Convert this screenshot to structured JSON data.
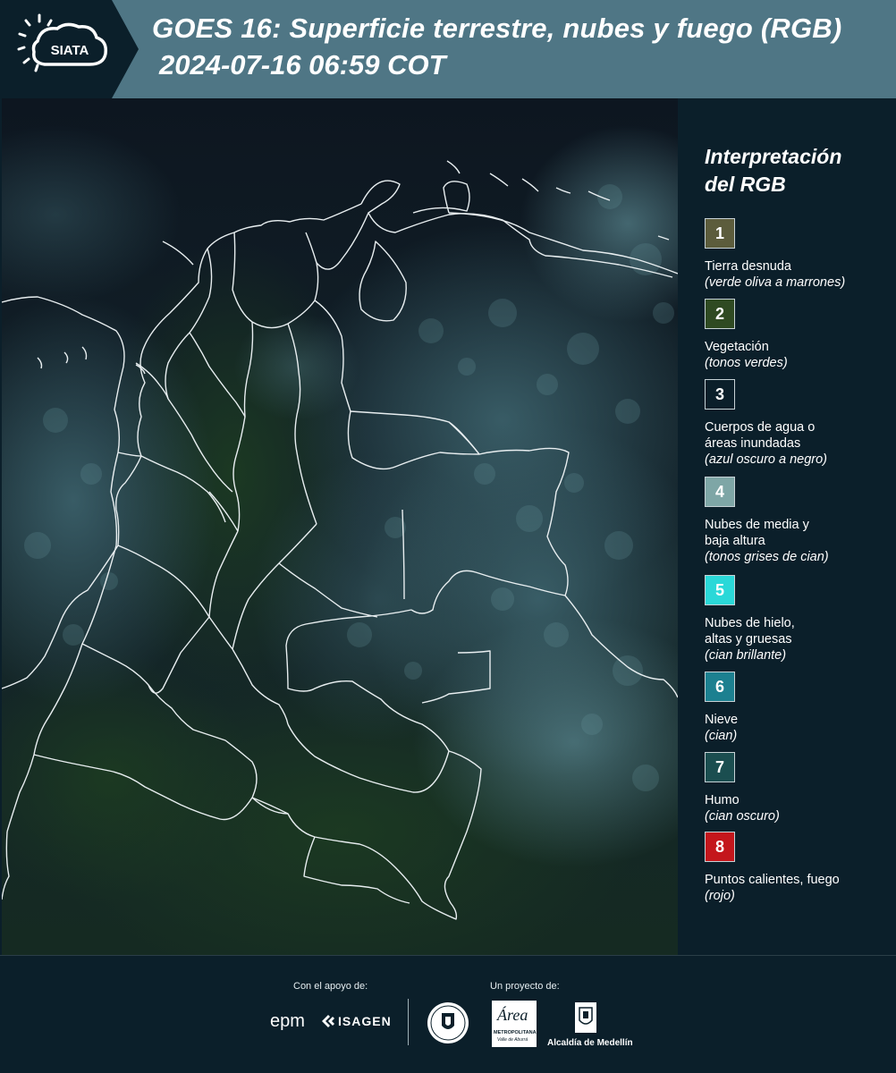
{
  "header": {
    "logo_text": "SIATA",
    "title_line1": "GOES 16: Superficie terrestre, nubes y fuego (RGB)",
    "title_line2": "2024-07-16 06:59 COT"
  },
  "map": {
    "icon": "satellite-map-icon"
  },
  "legend": {
    "title_line1": "Interpretación",
    "title_line2": "del RGB",
    "items": [
      {
        "number": "1",
        "color": "#5c5c3c",
        "label": "Tierra desnuda",
        "label2": "",
        "sub": "(verde oliva a marrones)"
      },
      {
        "number": "2",
        "color": "#2f4a22",
        "label": "Vegetación",
        "label2": "",
        "sub": "(tonos verdes)"
      },
      {
        "number": "3",
        "color": "#0b1f2a",
        "label": "Cuerpos de agua o",
        "label2": "áreas inundadas",
        "sub": "(azul oscuro a negro)"
      },
      {
        "number": "4",
        "color": "#7ea6a6",
        "label": "Nubes de media y",
        "label2": "baja altura",
        "sub": "(tonos grises de cian)"
      },
      {
        "number": "5",
        "color": "#2ad8d8",
        "label": "Nubes de hielo,",
        "label2": "altas y gruesas",
        "sub": "(cian brillante)"
      },
      {
        "number": "6",
        "color": "#1c8090",
        "label": "Nieve",
        "label2": "",
        "sub": "(cian)"
      },
      {
        "number": "7",
        "color": "#1b4e50",
        "label": "Humo",
        "label2": "",
        "sub": "(cian oscuro)"
      },
      {
        "number": "8",
        "color": "#c4161c",
        "label": "Puntos calientes, fuego",
        "label2": "",
        "sub": "(rojo)"
      }
    ]
  },
  "footer": {
    "support_label": "Con el apoyo de:",
    "project_label": "Un proyecto de:",
    "sponsor1": "epm",
    "sponsor2": "ISAGEN",
    "area_name": "Área",
    "area_sub": "METROPOLITANA",
    "area_sub2": "Valle de Aburrá",
    "alcaldia": "Alcaldía de Medellín"
  }
}
